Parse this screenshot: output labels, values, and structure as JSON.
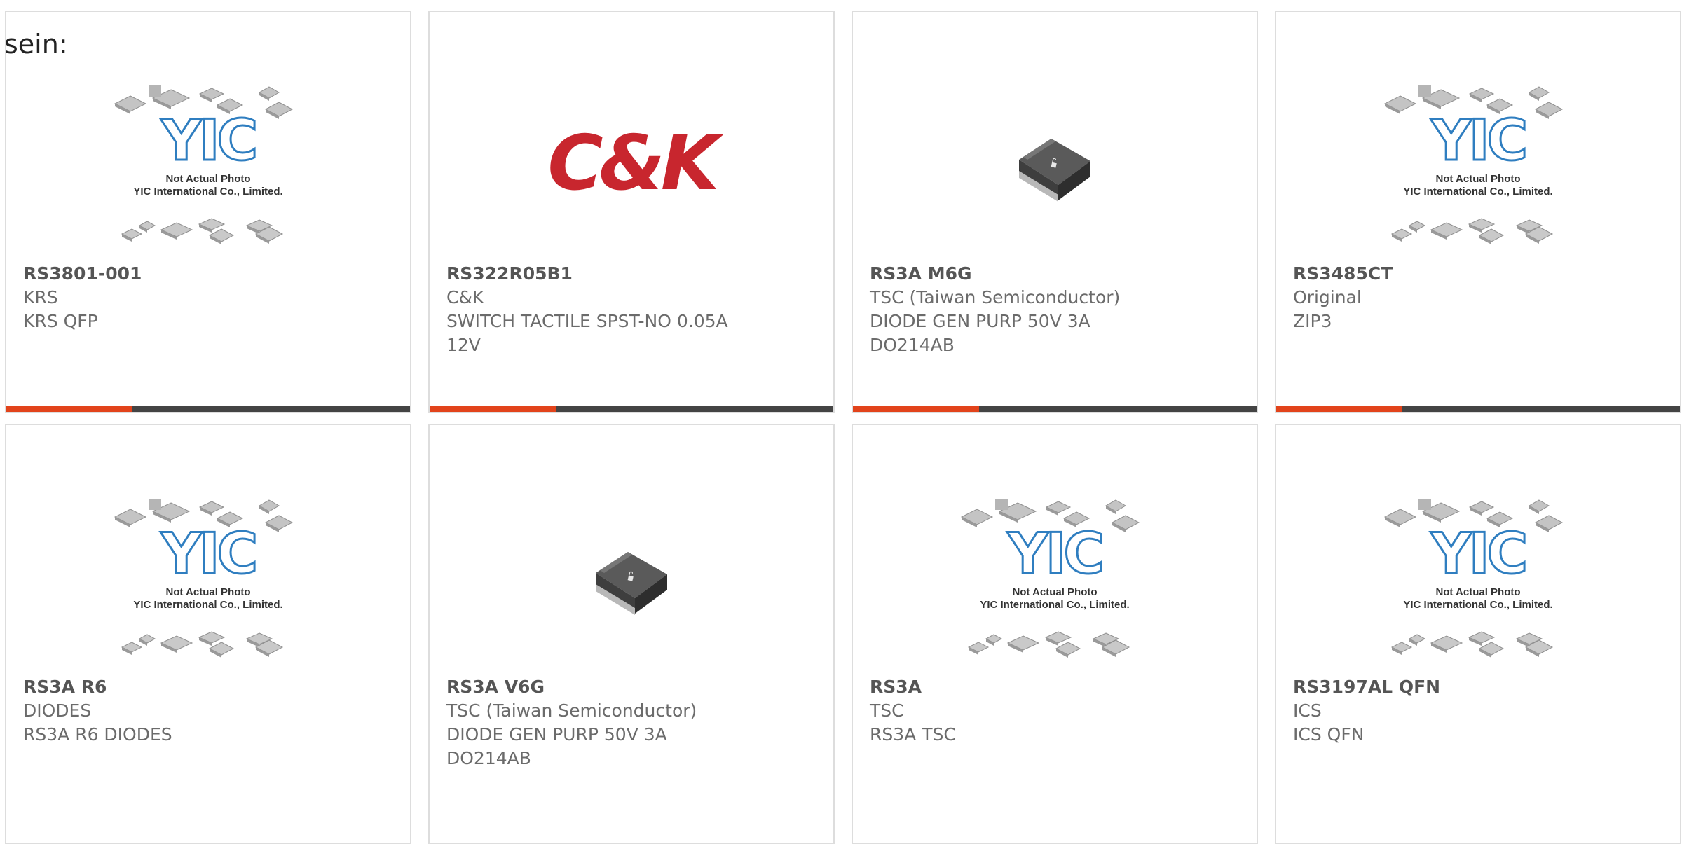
{
  "intro_text": "sein:",
  "placeholder_image": {
    "caption_line1": "Not Actual Photo",
    "caption_line2": "YIC International Co., Limited.",
    "logo_text": "YIC"
  },
  "ck_logo_text": "C&K",
  "colors": {
    "accent": "#e2431b",
    "bar": "#444444",
    "yic_blue": "#2f7ec0",
    "ck_red": "#c8262e",
    "text": "#666666"
  },
  "products": [
    {
      "part": "RS3801-001",
      "brand": "KRS",
      "line3": "KRS QFP",
      "line4": "",
      "image": "yic-placeholder"
    },
    {
      "part": "RS322R05B1",
      "brand": "C&K",
      "line3": "SWITCH TACTILE SPST-NO 0.05A",
      "line4": "12V",
      "image": "ck-logo"
    },
    {
      "part": "RS3A M6G",
      "brand": "TSC (Taiwan Semiconductor)",
      "line3": "DIODE GEN PURP 50V 3A",
      "line4": "DO214AB",
      "image": "smd-diode"
    },
    {
      "part": "RS3485CT",
      "brand": "Original",
      "line3": "ZIP3",
      "line4": "",
      "image": "yic-placeholder"
    },
    {
      "part": "RS3A R6",
      "brand": "DIODES",
      "line3": "RS3A R6 DIODES",
      "line4": "",
      "image": "yic-placeholder"
    },
    {
      "part": "RS3A V6G",
      "brand": "TSC (Taiwan Semiconductor)",
      "line3": "DIODE GEN PURP 50V 3A",
      "line4": "DO214AB",
      "image": "smd-diode"
    },
    {
      "part": "RS3A",
      "brand": "TSC",
      "line3": "RS3A TSC",
      "line4": "",
      "image": "yic-placeholder"
    },
    {
      "part": "RS3197AL QFN",
      "brand": "ICS",
      "line3": "ICS QFN",
      "line4": "",
      "image": "yic-placeholder"
    }
  ]
}
